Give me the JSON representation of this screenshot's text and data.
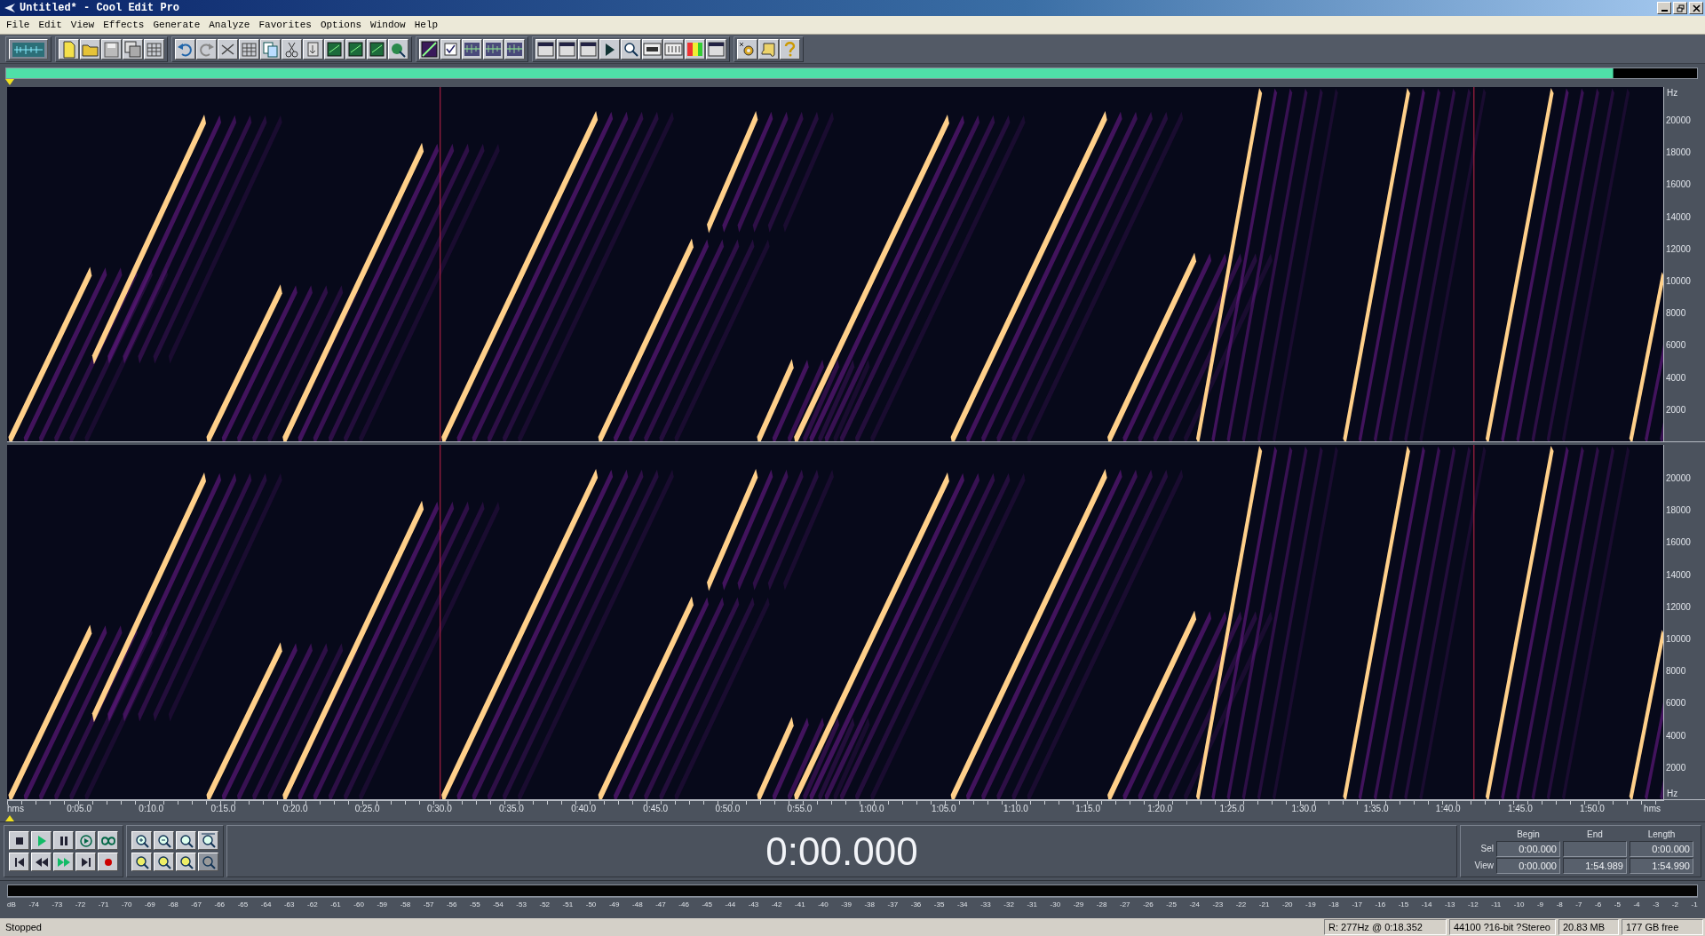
{
  "window": {
    "title": "Untitled* - Cool Edit Pro"
  },
  "menu": [
    {
      "label": "File"
    },
    {
      "label": "Edit"
    },
    {
      "label": "View"
    },
    {
      "label": "Effects"
    },
    {
      "label": "Generate"
    },
    {
      "label": "Analyze"
    },
    {
      "label": "Favorites"
    },
    {
      "label": "Options"
    },
    {
      "label": "Window"
    },
    {
      "label": "Help"
    }
  ],
  "spectrogram": {
    "channels": [
      {
        "unit_top": "Hz",
        "hz_labels": [
          "20000",
          "18000",
          "16000",
          "14000",
          "12000",
          "10000",
          "8000",
          "6000",
          "4000",
          "2000"
        ]
      },
      {
        "unit_bottom": "Hz",
        "hz_labels": [
          "20000",
          "18000",
          "16000",
          "14000",
          "12000",
          "10000",
          "8000",
          "6000",
          "4000",
          "2000"
        ]
      }
    ]
  },
  "time_ruler": {
    "start_label": "hms",
    "end_label": "hms",
    "labels": [
      "0:05.0",
      "0:10.0",
      "0:15.0",
      "0:20.0",
      "0:25.0",
      "0:30.0",
      "0:35.0",
      "0:40.0",
      "0:45.0",
      "0:50.0",
      "0:55.0",
      "1:00.0",
      "1:05.0",
      "1:10.0",
      "1:15.0",
      "1:20.0",
      "1:25.0",
      "1:30.0",
      "1:35.0",
      "1:40.0",
      "1:45.0",
      "1:50.0"
    ]
  },
  "time_display": "0:00.000",
  "range_panel": {
    "columns": [
      "Begin",
      "End",
      "Length"
    ],
    "rows": [
      {
        "label": "Sel",
        "begin": "0:00.000",
        "length": "0:00.000"
      },
      {
        "label": "View",
        "begin": "0:00.000",
        "end": "1:54.989",
        "length": "1:54.990"
      }
    ]
  },
  "level_meter": {
    "labels": [
      "dB",
      "-74",
      "-73",
      "-72",
      "-71",
      "-70",
      "-69",
      "-68",
      "-67",
      "-66",
      "-65",
      "-64",
      "-63",
      "-62",
      "-61",
      "-60",
      "-59",
      "-58",
      "-57",
      "-56",
      "-55",
      "-54",
      "-53",
      "-52",
      "-51",
      "-50",
      "-49",
      "-48",
      "-47",
      "-46",
      "-45",
      "-44",
      "-43",
      "-42",
      "-41",
      "-40",
      "-39",
      "-38",
      "-37",
      "-36",
      "-35",
      "-34",
      "-33",
      "-32",
      "-31",
      "-30",
      "-29",
      "-28",
      "-27",
      "-26",
      "-25",
      "-24",
      "-23",
      "-22",
      "-21",
      "-20",
      "-19",
      "-18",
      "-17",
      "-16",
      "-15",
      "-14",
      "-13",
      "-12",
      "-11",
      "-10",
      "-9",
      "-8",
      "-7",
      "-6",
      "-5",
      "-4",
      "-3",
      "-2",
      "-1"
    ]
  },
  "status_bar": {
    "state": "Stopped",
    "cursor": "R: 277Hz @  0:18.352",
    "format": "44100 ?16-bit ?Stereo",
    "size": "20.83 MB",
    "free": "177 GB free"
  }
}
